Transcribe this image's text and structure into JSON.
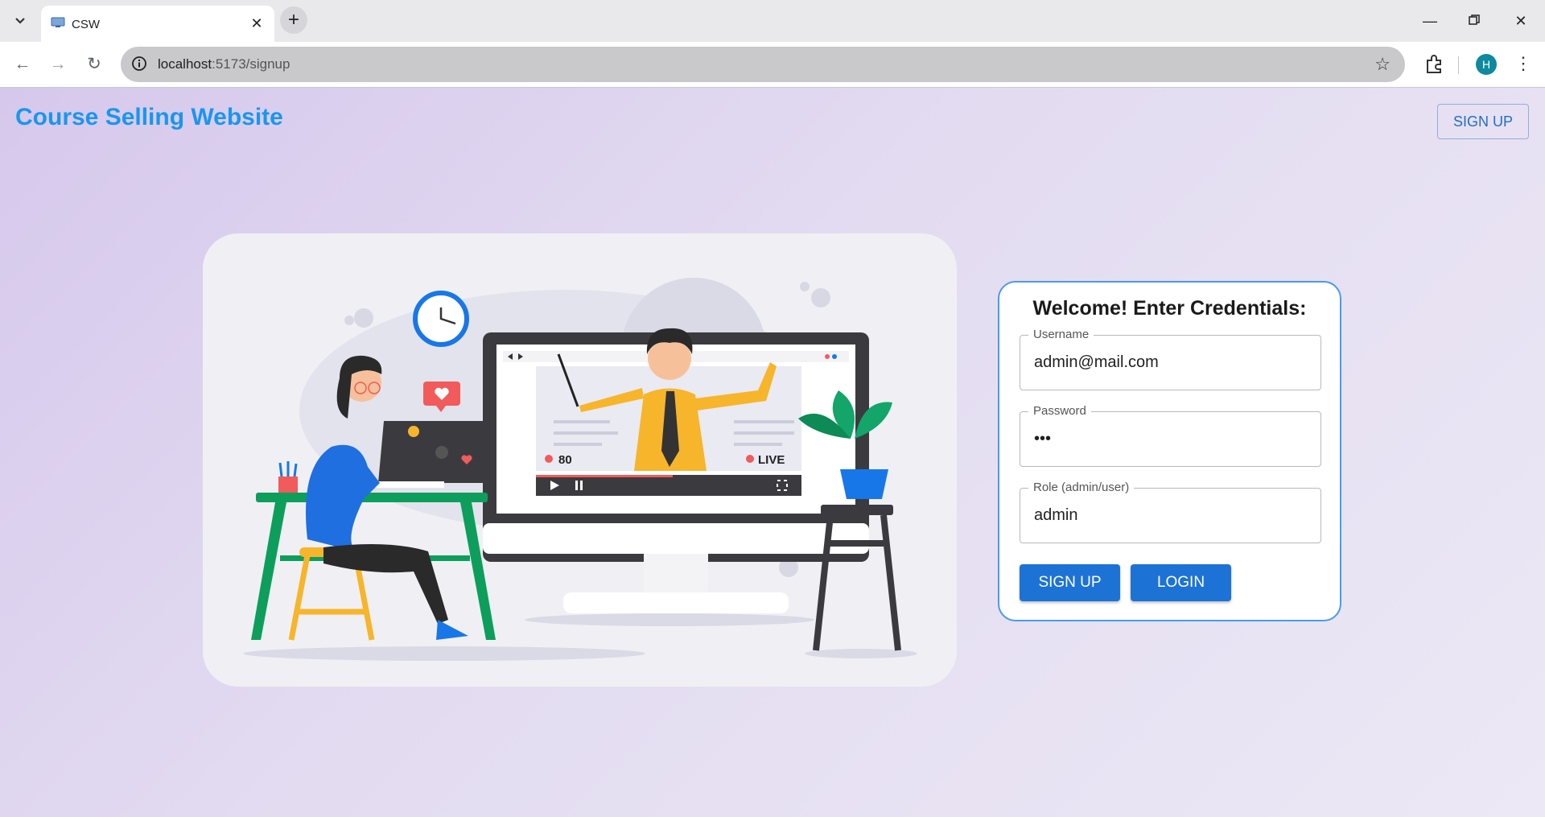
{
  "browser": {
    "tab_title": "CSW",
    "url_host": "localhost",
    "url_path": ":5173/signup",
    "profile_initial": "H",
    "icons": [
      "tab-list-icon",
      "favicon-icon",
      "close-icon",
      "plus-icon",
      "minimize-icon",
      "restore-icon",
      "close-window-icon",
      "back-icon",
      "forward-icon",
      "reload-icon",
      "site-info-icon",
      "star-icon",
      "extensions-icon",
      "more-icon"
    ]
  },
  "header": {
    "brand": "Course Selling Website",
    "signup_label": "SIGN UP"
  },
  "illustration": {
    "viewers": "80",
    "live_label": "LIVE"
  },
  "login": {
    "title": "Welcome! Enter Credentials:",
    "username_label": "Username",
    "username_value": "admin@mail.com",
    "password_label": "Password",
    "password_value": "•••",
    "role_label": "Role (admin/user)",
    "role_value": "admin",
    "signup_label": "SIGN UP",
    "login_label": "LOGIN"
  },
  "colors": {
    "brand": "#1a96ee",
    "primary_button": "#1d72d6",
    "card_border": "#4a9af0",
    "page_bg": "#dcd4ee"
  }
}
